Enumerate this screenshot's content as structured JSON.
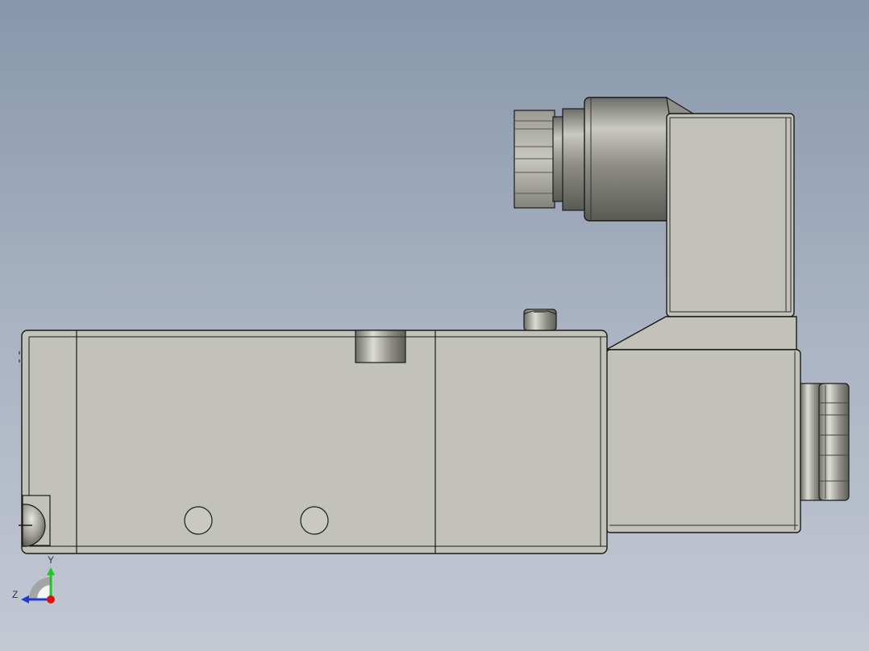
{
  "viewport": {
    "background_top": "#8797ab",
    "background_bottom": "#c3c8d3"
  },
  "model": {
    "body_color": "#c2c2bb",
    "edge_color": "#1a1a1a",
    "metal_color": "#b9b8b0"
  },
  "triad": {
    "axis_y_label": "Y",
    "axis_z_label": "Z",
    "y_color": "#1ec81e",
    "z_color": "#1f3ad6",
    "x_color": "#e01010"
  }
}
